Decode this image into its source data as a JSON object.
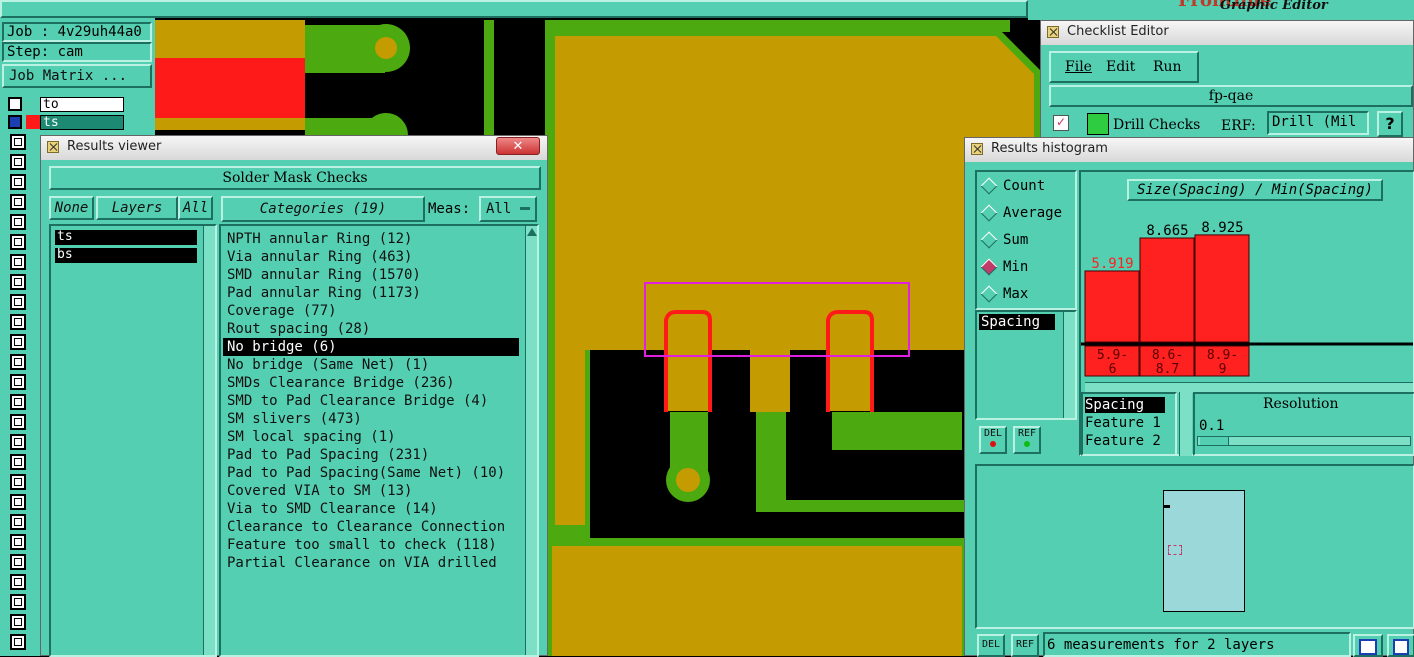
{
  "job": {
    "job_label": "Job : 4v29uh44a0",
    "step_label": "Step: cam",
    "matrix_button": "Job Matrix ..."
  },
  "layers_mini": [
    {
      "name": "to"
    },
    {
      "name": "ts"
    }
  ],
  "header_logo": {
    "brand_partial": "Frontline",
    "subtitle": "Graphic Editor"
  },
  "results_viewer": {
    "title": "Results viewer",
    "close_label": "✕",
    "section": "Solder Mask Checks",
    "none_btn": "None",
    "layers_btn": "Layers",
    "all_btn": "All",
    "categories_btn": "Categories (19)",
    "meas_label": "Meas:",
    "meas_value": "All",
    "layers": [
      "ts",
      "bs"
    ],
    "categories": [
      "NPTH annular Ring (12)",
      "Via annular Ring (463)",
      "SMD annular Ring (1570)",
      "Pad annular Ring (1173)",
      "Coverage (77)",
      "Rout spacing (28)",
      "No bridge (6)",
      "No bridge (Same Net) (1)",
      "SMDs Clearance Bridge (236)",
      "SMD to Pad Clearance Bridge (4)",
      "SM slivers (473)",
      "SM local spacing (1)",
      "Pad to Pad Spacing (231)",
      "Pad to Pad Spacing(Same Net) (10)",
      "Covered VIA to SM (13)",
      "Via to SMD Clearance (14)",
      "Clearance to Clearance Connection",
      "Feature too small to check (118)",
      "Partial Clearance on VIA drilled"
    ],
    "selected_index": 6
  },
  "checklist_editor": {
    "title": "Checklist Editor",
    "menu": [
      "File",
      "Edit",
      "Run"
    ],
    "name": "fp-qae",
    "drill_checks": "Drill Checks",
    "erf_label": "ERF:",
    "erf_value": "Drill (Mil",
    "help": "?"
  },
  "results_histogram": {
    "title": "Results histogram",
    "modes": [
      "Count",
      "Average",
      "Sum",
      "Min",
      "Max"
    ],
    "selected_mode": "Min",
    "chart_title": "Size(Spacing) / Min(Spacing)",
    "list_item": "Spacing",
    "del_label": "DEL",
    "ref_label": "REF",
    "attrs": [
      "Spacing",
      "Feature 1",
      "Feature 2"
    ],
    "resolution_label": "Resolution",
    "resolution_value": "0.1",
    "status": "6 measurements for 2 layers"
  },
  "chart_data": {
    "type": "bar",
    "title": "Size(Spacing) / Min(Spacing)",
    "categories": [
      "5.9-6",
      "8.6-8.7",
      "8.9-9"
    ],
    "values": [
      5.919,
      8.665,
      8.925
    ],
    "value_labels": [
      "5.919",
      "8.665",
      "8.925"
    ],
    "ylim": [
      0,
      10
    ],
    "colors": {
      "bar": "#ff2020",
      "label_highlight": "#ff2020"
    }
  },
  "colors": {
    "teal": "#55cfb1",
    "copper": "#c49b00",
    "green": "#4caa10",
    "red": "#ff1a1a",
    "highlight": "#e020e0"
  }
}
